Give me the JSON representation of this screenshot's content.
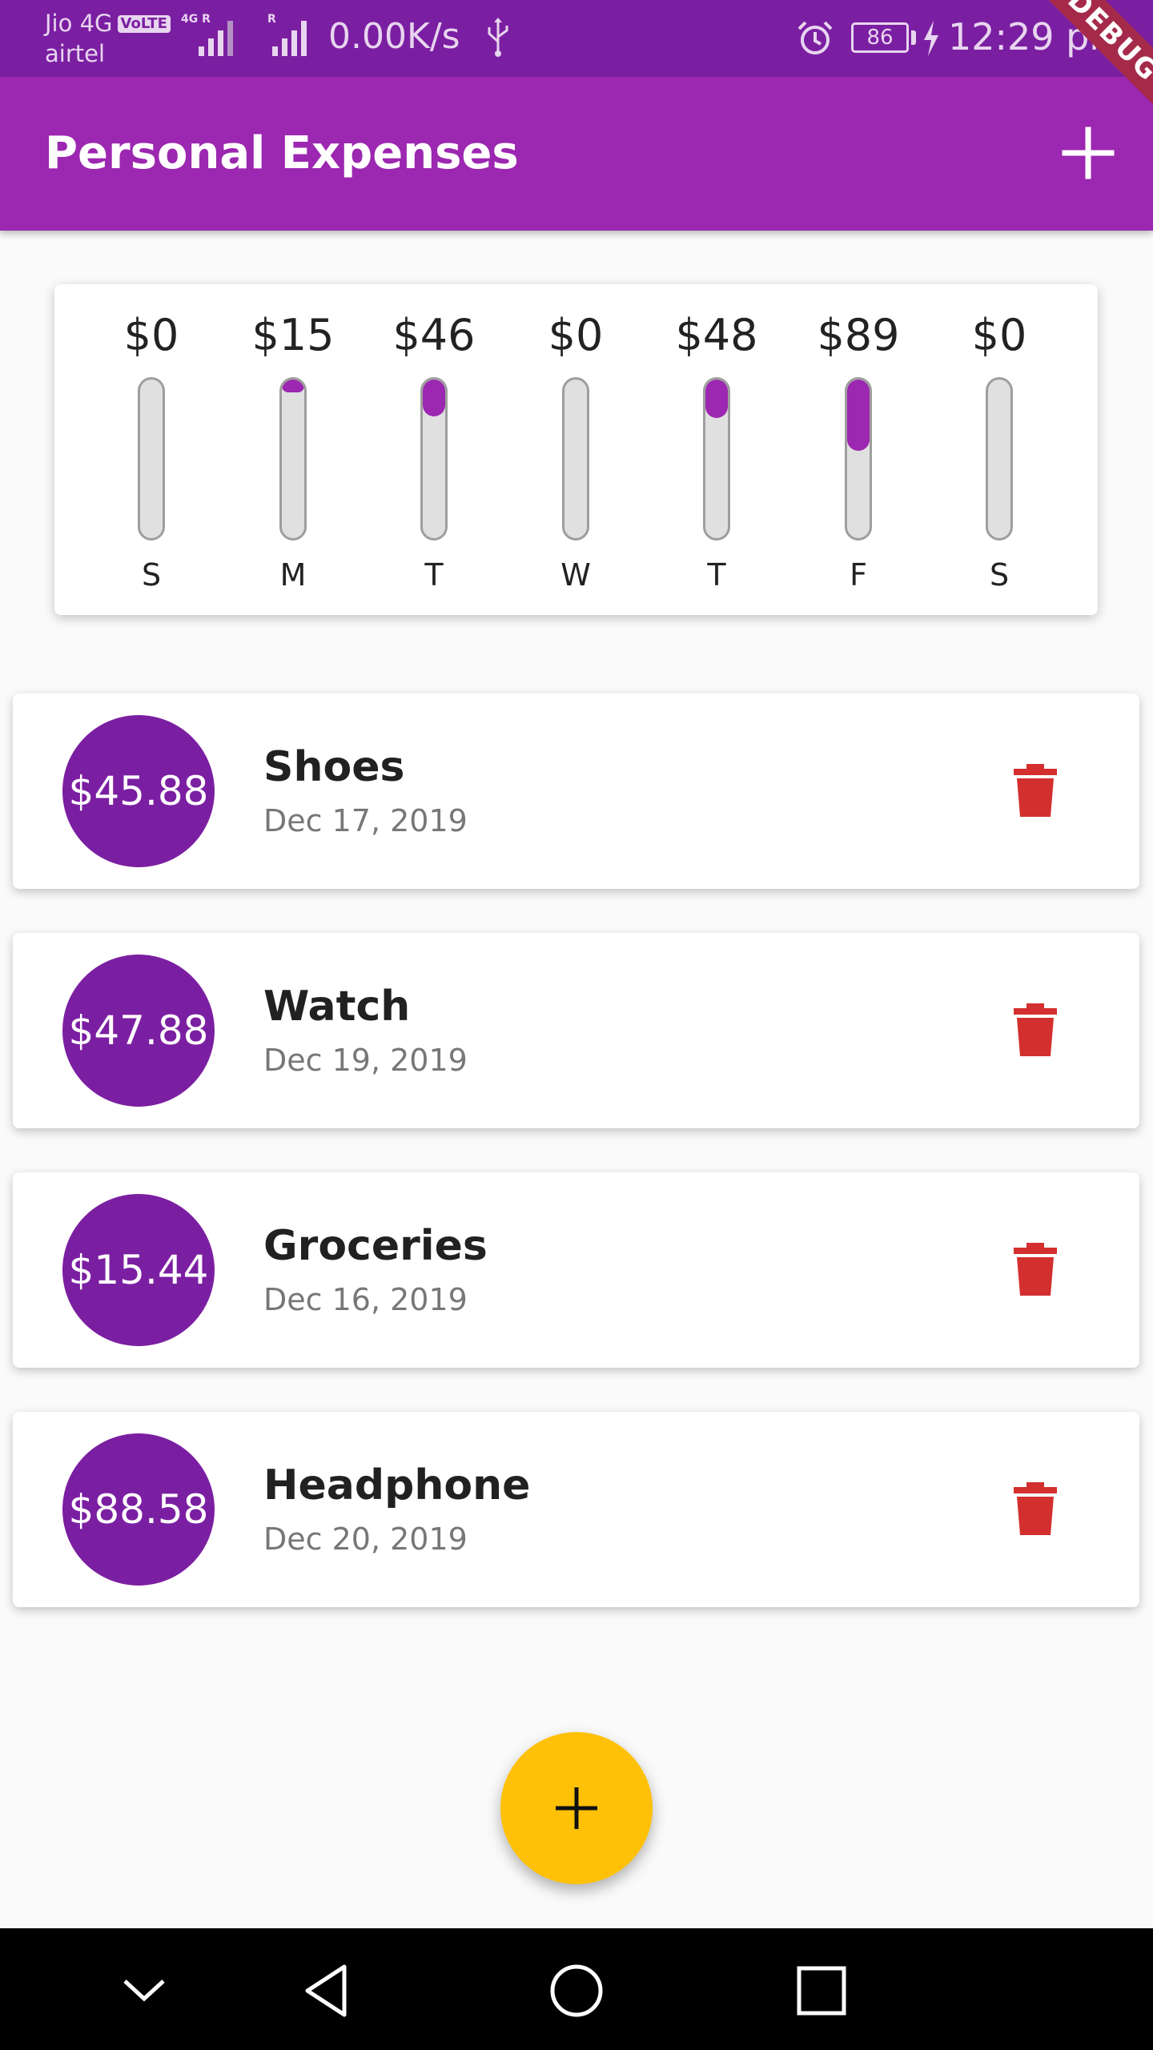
{
  "status_bar": {
    "carrier_primary": "Jio 4G",
    "volte_badge": "VoLTE",
    "network_tag": "4G R",
    "roaming_tag": "R",
    "carrier_secondary": "airtel",
    "net_speed": "0.00K/s",
    "battery": "86",
    "time": "12:29 pm"
  },
  "debug_ribbon": "DEBUG",
  "app_bar": {
    "title": "Personal Expenses",
    "add_icon": "plus-icon",
    "background": "#9c27b0"
  },
  "chart_data": {
    "type": "bar",
    "categories": [
      "S",
      "M",
      "T",
      "W",
      "T",
      "F",
      "S"
    ],
    "amount_labels": [
      "$0",
      "$15",
      "$46",
      "$0",
      "$48",
      "$89",
      "$0"
    ],
    "values": [
      0,
      15,
      46,
      0,
      48,
      89,
      0
    ],
    "fill_fraction_of_total": [
      0,
      0.08,
      0.23,
      0,
      0.24,
      0.45,
      0
    ],
    "title": "",
    "xlabel": "",
    "ylabel": "",
    "fill_color": "#9c27b0",
    "track_color": "#e0e0e0"
  },
  "transactions": [
    {
      "amount": "$45.88",
      "title": "Shoes",
      "date": "Dec 17, 2019",
      "delete_icon": "trash-icon"
    },
    {
      "amount": "$47.88",
      "title": "Watch",
      "date": "Dec 19, 2019",
      "delete_icon": "trash-icon"
    },
    {
      "amount": "$15.44",
      "title": "Groceries",
      "date": "Dec 16, 2019",
      "delete_icon": "trash-icon"
    },
    {
      "amount": "$88.58",
      "title": "Headphone",
      "date": "Dec 20, 2019",
      "delete_icon": "trash-icon"
    }
  ],
  "colors": {
    "avatar": "#7b1fa2",
    "delete": "#d32f2f",
    "fab": "#ffc107",
    "status_bar": "#7b1fa2"
  },
  "fab": {
    "icon": "plus-icon"
  },
  "nav_bar": {
    "icons": [
      "chevron-down-icon",
      "back-icon",
      "home-icon",
      "recents-icon"
    ]
  }
}
